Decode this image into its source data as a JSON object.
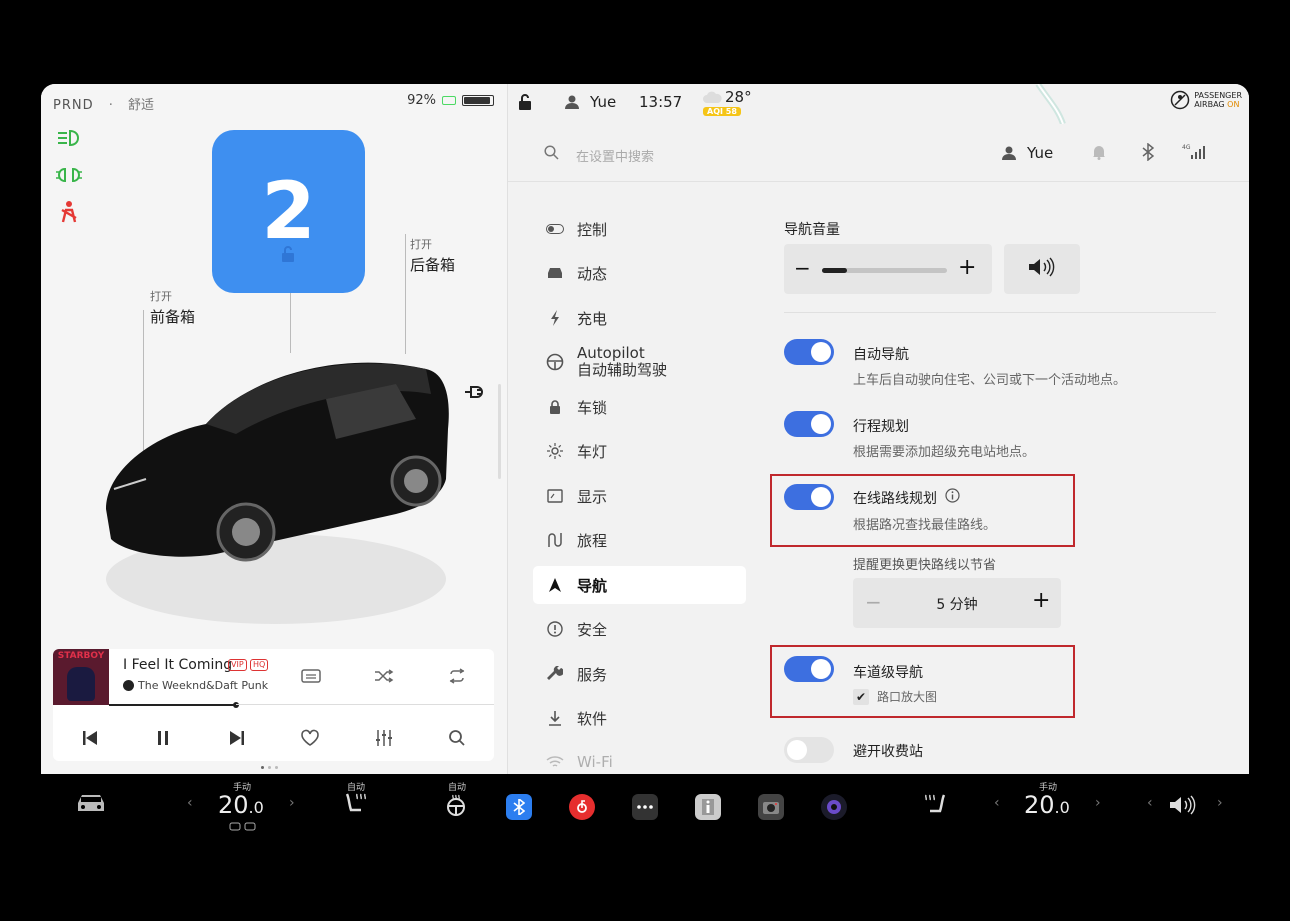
{
  "status_left": {
    "gears": "PRND",
    "separator": "·",
    "drive_mode": "舒适"
  },
  "battery": {
    "percent": "92%",
    "level": 0.92
  },
  "gear_display": {
    "value": "2"
  },
  "trunk": {
    "front": {
      "action": "打开",
      "label": "前备箱"
    },
    "rear": {
      "action": "打开",
      "label": "后备箱"
    }
  },
  "music": {
    "album_text": "STARBOY",
    "song": "I Feel It Coming",
    "badge_vip": "VIP",
    "badge_hq": "HQ",
    "artist": "The Weeknd&Daft Punk",
    "progress": 0.33
  },
  "topbar": {
    "user": "Yue",
    "time": "13:57",
    "temperature": "28°",
    "aqi": "AQI 58",
    "airbag_line1": "PASSENGER",
    "airbag_line2": "AIRBAG",
    "airbag_state": "ON"
  },
  "search": {
    "placeholder": "在设置中搜索",
    "user": "Yue"
  },
  "sidebar": {
    "items": [
      {
        "label": "控制",
        "icon": "toggle-icon"
      },
      {
        "label": "动态",
        "icon": "car-icon"
      },
      {
        "label": "充电",
        "icon": "lightning-icon"
      },
      {
        "label": "Autopilot",
        "label2": "自动辅助驾驶",
        "icon": "steering-wheel-icon"
      },
      {
        "label": "车锁",
        "icon": "lock-icon"
      },
      {
        "label": "车灯",
        "icon": "sun-icon"
      },
      {
        "label": "显示",
        "icon": "display-icon"
      },
      {
        "label": "旅程",
        "icon": "trip-icon"
      },
      {
        "label": "导航",
        "icon": "navigation-arrow-icon",
        "active": true
      },
      {
        "label": "安全",
        "icon": "alert-circle-icon"
      },
      {
        "label": "服务",
        "icon": "wrench-icon"
      },
      {
        "label": "软件",
        "icon": "download-icon"
      },
      {
        "label": "Wi-Fi",
        "icon": "wifi-icon"
      }
    ]
  },
  "settings": {
    "nav_volume_title": "导航音量",
    "volume_level": 0.2,
    "minus": "−",
    "plus": "+",
    "options": [
      {
        "title": "自动导航",
        "desc": "上车后自动驶向住宅、公司或下一个活动地点。",
        "on": true
      },
      {
        "title": "行程规划",
        "desc": "根据需要添加超级充电站地点。",
        "on": true
      },
      {
        "title": "在线路线规划",
        "desc": "根据路况查找最佳路线。",
        "on": true
      },
      {
        "title": "车道级导航",
        "desc": "路口放大图",
        "on": true
      },
      {
        "title": "避开收费站",
        "desc": "",
        "on": false
      }
    ],
    "reroute_label": "提醒更换更快路线以节省",
    "reroute_value": "5 分钟",
    "checkbox_mark": "✔"
  },
  "dock": {
    "left_temp_mode": "手动",
    "left_temp": "20",
    "left_temp_decimal": ".0",
    "seat_heat_left_mode": "自动",
    "wheel_heat_mode": "自动",
    "right_temp_mode": "手动",
    "right_temp": "20",
    "right_temp_decimal": ".0",
    "arrow_left": "‹",
    "arrow_right": "›"
  },
  "colors": {
    "accent": "#3d6fe0",
    "gear_bg": "#3e8ff0",
    "highlight": "#c0282d",
    "green": "#4cd964"
  }
}
